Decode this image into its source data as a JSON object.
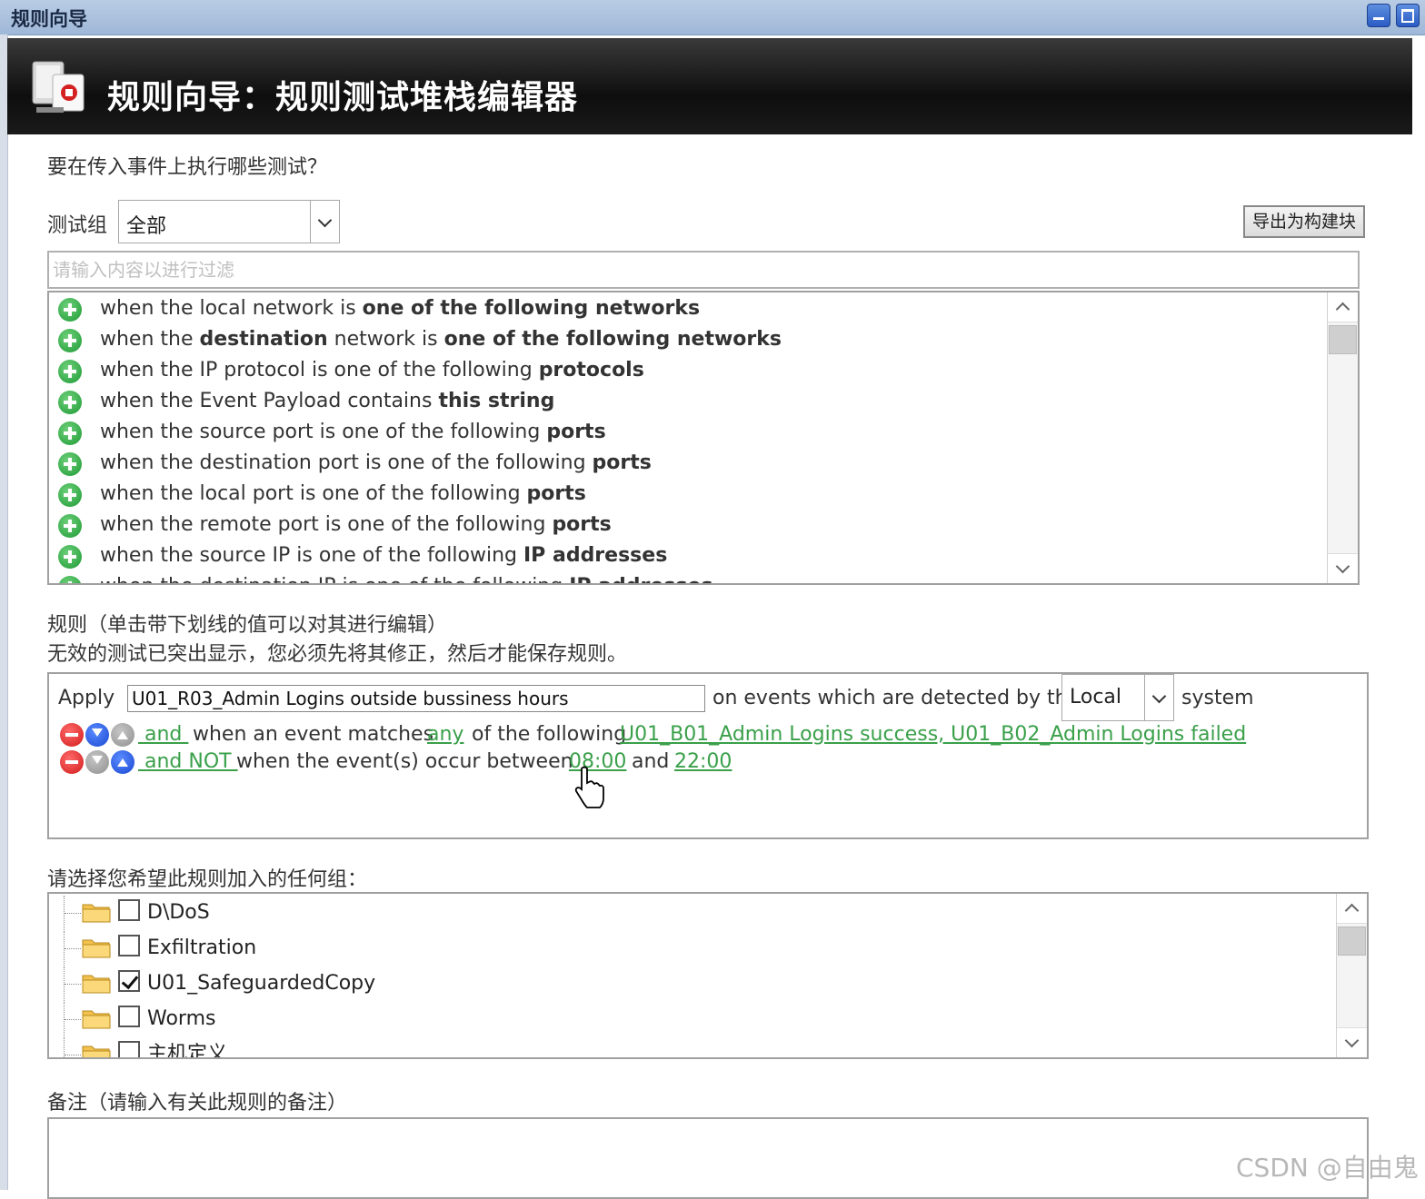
{
  "window": {
    "title": "规则向导"
  },
  "header": {
    "title": "规则向导：规则测试堆栈编辑器"
  },
  "question": "要在传入事件上执行哪些测试？",
  "test_group": {
    "label": "测试组",
    "value": "全部"
  },
  "export_button": "导出为构建块",
  "filter": {
    "placeholder": "请输入内容以进行过滤",
    "value": ""
  },
  "tests": [
    [
      {
        "t": "when the local network is ",
        "b": false
      },
      {
        "t": "one of the following networks",
        "b": true
      }
    ],
    [
      {
        "t": "when the ",
        "b": false
      },
      {
        "t": "destination",
        "b": true
      },
      {
        "t": " network is ",
        "b": false
      },
      {
        "t": "one of the following networks",
        "b": true
      }
    ],
    [
      {
        "t": "when the IP protocol is one of the following ",
        "b": false
      },
      {
        "t": "protocols",
        "b": true
      }
    ],
    [
      {
        "t": "when the Event Payload contains ",
        "b": false
      },
      {
        "t": "this string",
        "b": true
      }
    ],
    [
      {
        "t": "when the source port is one of the following ",
        "b": false
      },
      {
        "t": "ports",
        "b": true
      }
    ],
    [
      {
        "t": "when the destination port is one of the following ",
        "b": false
      },
      {
        "t": "ports",
        "b": true
      }
    ],
    [
      {
        "t": "when the local port is one of the following ",
        "b": false
      },
      {
        "t": "ports",
        "b": true
      }
    ],
    [
      {
        "t": "when the remote port is one of the following ",
        "b": false
      },
      {
        "t": "ports",
        "b": true
      }
    ],
    [
      {
        "t": "when the source IP is one of the following ",
        "b": false
      },
      {
        "t": "IP addresses",
        "b": true
      }
    ],
    [
      {
        "t": "when the destination IP is one of the following ",
        "b": false
      },
      {
        "t": "IP addresses",
        "b": true
      }
    ]
  ],
  "rule_section": {
    "title": "规则（单击带下划线的值可以对其进行编辑）",
    "note": "无效的测试已突出显示，您必须先将其修正，然后才能保存规则。"
  },
  "rule": {
    "apply_label": "Apply",
    "name": "U01_R03_Admin Logins outside bussiness hours",
    "detected_text": "on events which are detected by the",
    "system_value": "Local",
    "system_label": "system",
    "line1": {
      "and": " and ",
      "text1": "when an event matches ",
      "any": "any",
      "text2": " of the following ",
      "blocks": "U01_B01_Admin Logins success, U01_B02_Admin Logins failed"
    },
    "line2": {
      "and_not": " and NOT ",
      "text1": "when the event(s) occur between ",
      "start": "08:00",
      "text2": " and ",
      "end": "22:00"
    }
  },
  "groups_label": "请选择您希望此规则加入的任何组：",
  "groups": [
    {
      "name": "D\\DoS",
      "checked": false
    },
    {
      "name": "Exfiltration",
      "checked": false
    },
    {
      "name": "U01_SafeguardedCopy",
      "checked": true
    },
    {
      "name": "Worms",
      "checked": false
    },
    {
      "name": "主机定义",
      "checked": false
    }
  ],
  "notes_label": "备注（请输入有关此规则的备注）",
  "watermark": "CSDN @自由鬼",
  "colors": {
    "link": "#3aa04a",
    "header_bg": "#111111",
    "add_icon": "#1e9a35"
  }
}
